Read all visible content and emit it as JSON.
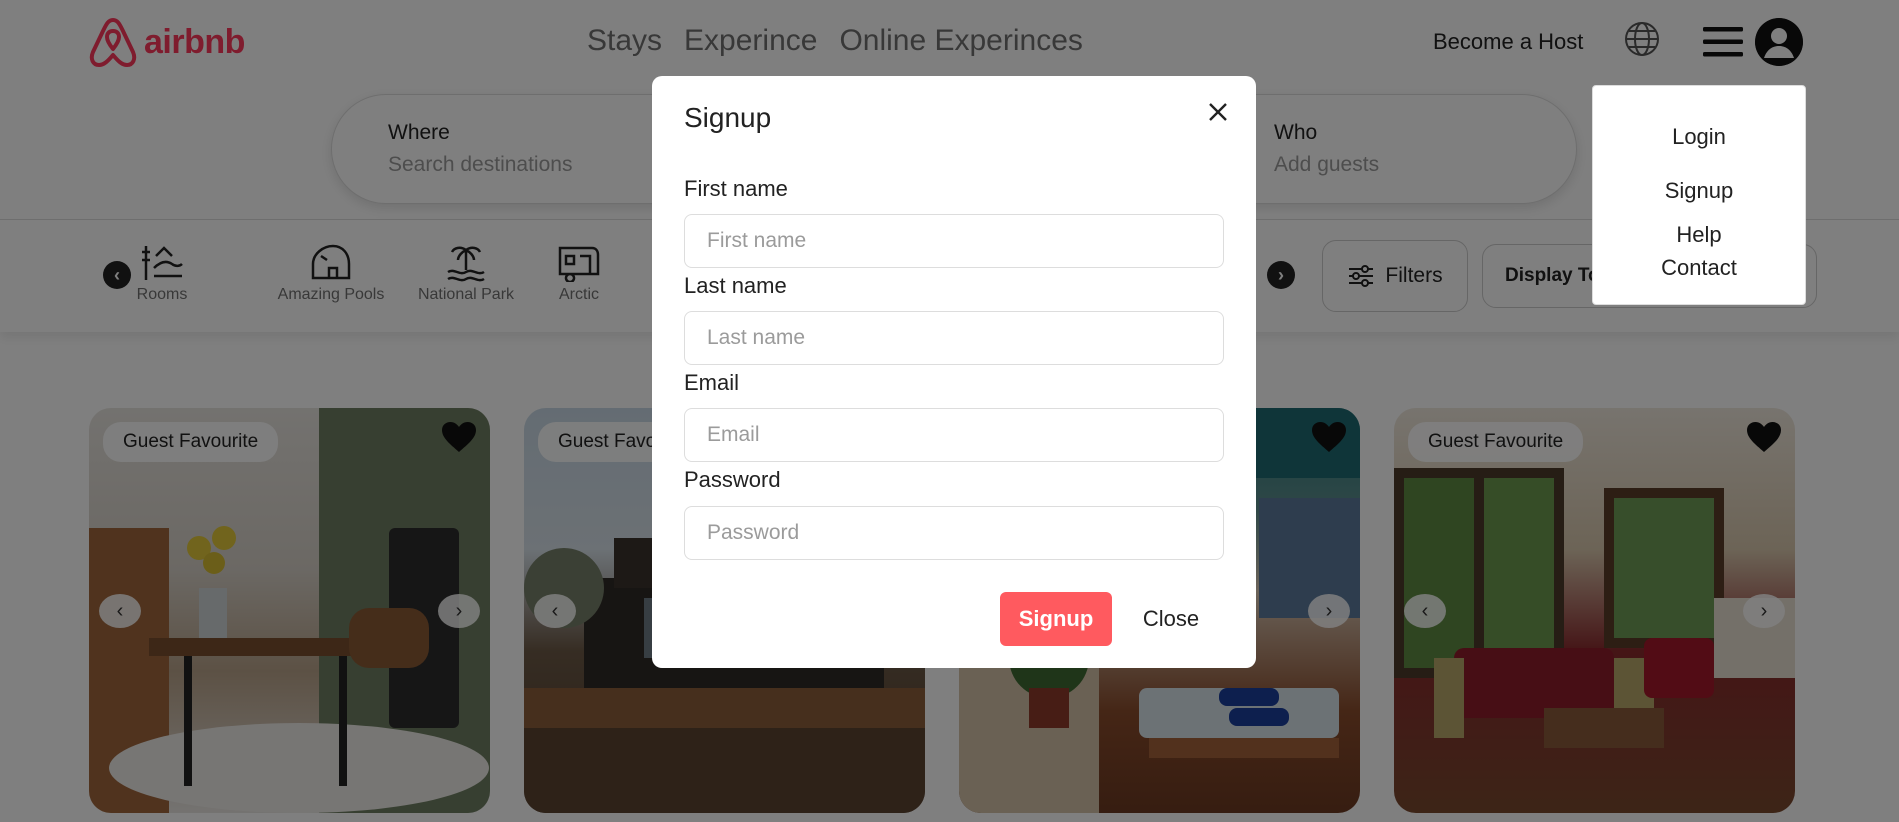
{
  "brand": {
    "name": "airbnb",
    "color": "#FF385C"
  },
  "nav": {
    "items": [
      "Stays",
      "Experince",
      "Online Experinces"
    ]
  },
  "header": {
    "host_link": "Become a Host",
    "globe_icon": "globe-icon",
    "menu_icon": "hamburger-icon",
    "avatar_icon": "user-avatar-icon"
  },
  "search": {
    "where": {
      "label": "Where",
      "placeholder": "Search destinations"
    },
    "who": {
      "label": "Who",
      "placeholder": "Add guests"
    }
  },
  "categories": {
    "items": [
      {
        "label": "Rooms",
        "icon": "rooms-icon"
      },
      {
        "label": "Amazing Pools",
        "icon": "pools-icon"
      },
      {
        "label": "National Park",
        "icon": "island-icon"
      },
      {
        "label": "Arctic",
        "icon": "camper-icon"
      }
    ],
    "filters_label": "Filters",
    "display_label": "Display To"
  },
  "listings": [
    {
      "badge": "Guest Favourite"
    },
    {
      "badge": "Guest Favourite"
    },
    {
      "badge": "Guest Favourite"
    },
    {
      "badge": "Guest Favourite"
    }
  ],
  "dropdown": {
    "items": [
      "Login",
      "Signup",
      "Help",
      "Contact"
    ]
  },
  "modal": {
    "title": "Signup",
    "fields": [
      {
        "label": "First name",
        "placeholder": "First name"
      },
      {
        "label": "Last name",
        "placeholder": "Last name"
      },
      {
        "label": "Email",
        "placeholder": "Email"
      },
      {
        "label": "Password",
        "placeholder": "Password"
      }
    ],
    "submit_label": "Signup",
    "close_label": "Close",
    "accent_color": "#FF5A5F"
  }
}
